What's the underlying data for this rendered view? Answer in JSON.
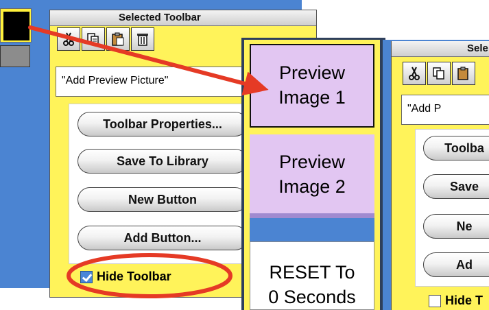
{
  "left_palette": {
    "title": "Selected Toolbar",
    "toolbar_icons": [
      "scissors-icon",
      "copy-icon",
      "paste-icon",
      "trash-icon"
    ],
    "name_field": "\"Add Preview Picture\"",
    "buttons": [
      "Toolbar Properties...",
      "Save To Library",
      "New Button",
      "Add Button..."
    ],
    "hide_toolbar": {
      "label": "Hide Toolbar",
      "checked": true
    }
  },
  "preview_panel": {
    "preview1": [
      "Preview",
      "Image 1"
    ],
    "preview2": [
      "Preview",
      "Image 2"
    ],
    "reset": [
      "RESET To",
      "0 Seconds"
    ]
  },
  "right_palette": {
    "title": "Sele",
    "name_field": "\"Add P",
    "buttons": [
      "Toolba",
      "Save",
      "Ne",
      "Ad"
    ],
    "hide_toolbar": {
      "label": "Hide T",
      "checked": false
    }
  },
  "colors": {
    "desktop_blue": "#4b84d2",
    "palette_yellow": "#fff35a",
    "preview_lavender": "#e2c6f2",
    "annotation_red": "#e53a25",
    "color_well": "#000000"
  }
}
